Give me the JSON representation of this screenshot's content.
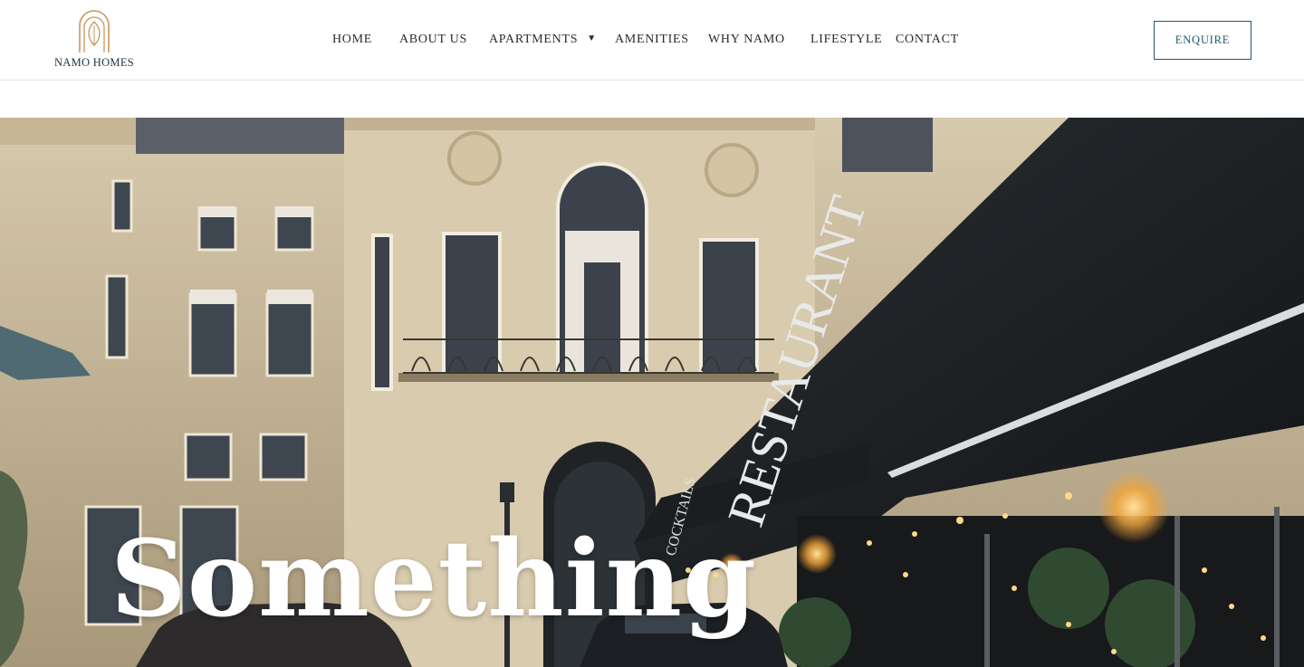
{
  "brand": {
    "name": "NAMO HOMES",
    "logo_icon": "arch-leaf-logo-icon",
    "accent_color": "#c9965a"
  },
  "nav": {
    "items": [
      {
        "label": "HOME"
      },
      {
        "label": "ABOUT US"
      },
      {
        "label": "APARTMENTS",
        "has_dropdown": true,
        "dropdown_icon": "caret-down-icon"
      },
      {
        "label": "AMENITIES"
      },
      {
        "label": "WHY NAMO"
      },
      {
        "label": "LIFESTYLE"
      },
      {
        "label": "CONTACT"
      }
    ]
  },
  "cta": {
    "label": "ENQUIRE",
    "color": "#1f5a6b"
  },
  "hero": {
    "headline": "Something",
    "awning_text": "RESTAURANT",
    "awning_small_text": "COCKTAILS",
    "media": "video-background-paris-street"
  }
}
